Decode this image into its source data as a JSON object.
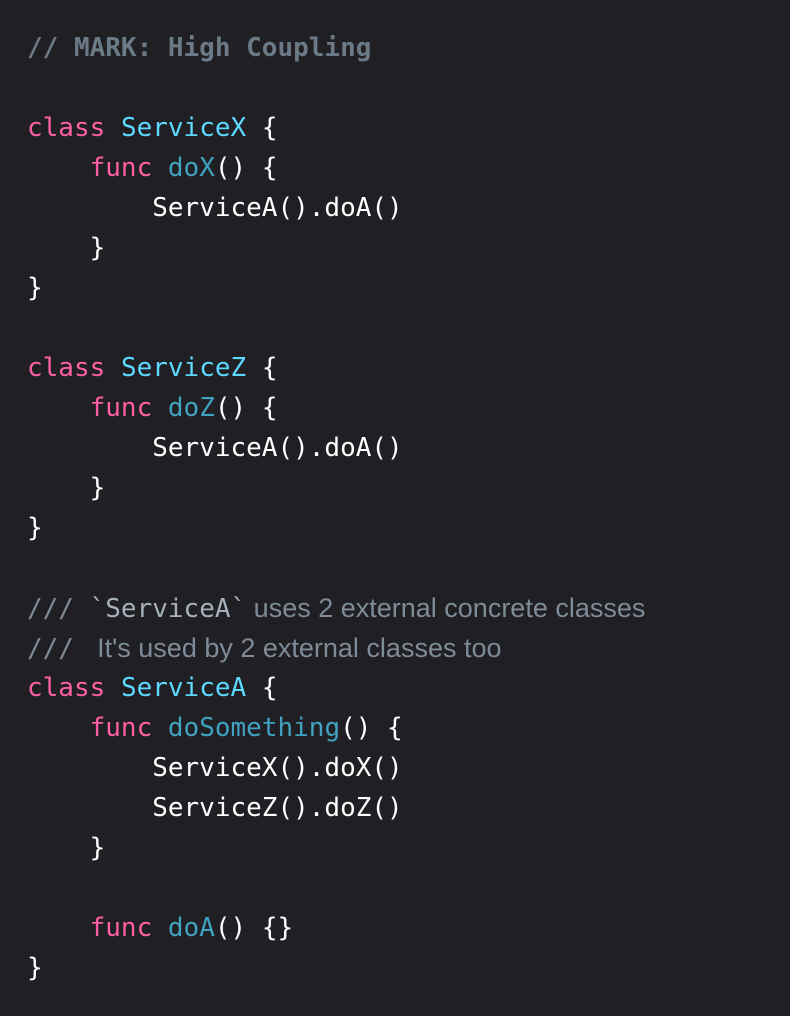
{
  "editor": {
    "language": "Swift",
    "theme": {
      "background": "#1f1f24",
      "keyword": "#fc5fa3",
      "type_declaration": "#5dd8ff",
      "function_declaration": "#41a1c0",
      "comment": "#7f8c98",
      "mark_comment": "#6c7986",
      "plain_text": "#ffffff"
    },
    "lines": [
      [
        {
          "t": "// MARK: High Coupling",
          "k": "mark-comment"
        }
      ],
      [],
      [
        {
          "t": "class",
          "k": "keyword"
        },
        {
          "t": " ",
          "k": "plain"
        },
        {
          "t": "ServiceX",
          "k": "type"
        },
        {
          "t": " {",
          "k": "plain"
        }
      ],
      [
        {
          "t": "    ",
          "k": "plain"
        },
        {
          "t": "func",
          "k": "keyword"
        },
        {
          "t": " ",
          "k": "plain"
        },
        {
          "t": "doX",
          "k": "func"
        },
        {
          "t": "() {",
          "k": "plain"
        }
      ],
      [
        {
          "t": "        ServiceA().doA()",
          "k": "plain"
        }
      ],
      [
        {
          "t": "    }",
          "k": "plain"
        }
      ],
      [
        {
          "t": "}",
          "k": "plain"
        }
      ],
      [],
      [
        {
          "t": "class",
          "k": "keyword"
        },
        {
          "t": " ",
          "k": "plain"
        },
        {
          "t": "ServiceZ",
          "k": "type"
        },
        {
          "t": " {",
          "k": "plain"
        }
      ],
      [
        {
          "t": "    ",
          "k": "plain"
        },
        {
          "t": "func",
          "k": "keyword"
        },
        {
          "t": " ",
          "k": "plain"
        },
        {
          "t": "doZ",
          "k": "func"
        },
        {
          "t": "() {",
          "k": "plain"
        }
      ],
      [
        {
          "t": "        ServiceA().doA()",
          "k": "plain"
        }
      ],
      [
        {
          "t": "    }",
          "k": "plain"
        }
      ],
      [
        {
          "t": "}",
          "k": "plain"
        }
      ],
      [],
      [
        {
          "t": "/// ",
          "k": "comment"
        },
        {
          "t": "`ServiceA`",
          "k": "doc-code"
        },
        {
          "t": " uses 2 external concrete classes",
          "k": "doc-prose"
        }
      ],
      [
        {
          "t": "/// ",
          "k": "comment"
        },
        {
          "t": " It's used by 2 external classes too",
          "k": "doc-prose"
        }
      ],
      [
        {
          "t": "class",
          "k": "keyword"
        },
        {
          "t": " ",
          "k": "plain"
        },
        {
          "t": "ServiceA",
          "k": "type"
        },
        {
          "t": " {",
          "k": "plain"
        }
      ],
      [
        {
          "t": "    ",
          "k": "plain"
        },
        {
          "t": "func",
          "k": "keyword"
        },
        {
          "t": " ",
          "k": "plain"
        },
        {
          "t": "doSomething",
          "k": "func"
        },
        {
          "t": "() {",
          "k": "plain"
        }
      ],
      [
        {
          "t": "        ServiceX().doX()",
          "k": "plain"
        }
      ],
      [
        {
          "t": "        ServiceZ().doZ()",
          "k": "plain"
        }
      ],
      [
        {
          "t": "    }",
          "k": "plain"
        }
      ],
      [],
      [
        {
          "t": "    ",
          "k": "plain"
        },
        {
          "t": "func",
          "k": "keyword"
        },
        {
          "t": " ",
          "k": "plain"
        },
        {
          "t": "doA",
          "k": "func"
        },
        {
          "t": "() {}",
          "k": "plain"
        }
      ],
      [
        {
          "t": "}",
          "k": "plain"
        }
      ]
    ]
  }
}
